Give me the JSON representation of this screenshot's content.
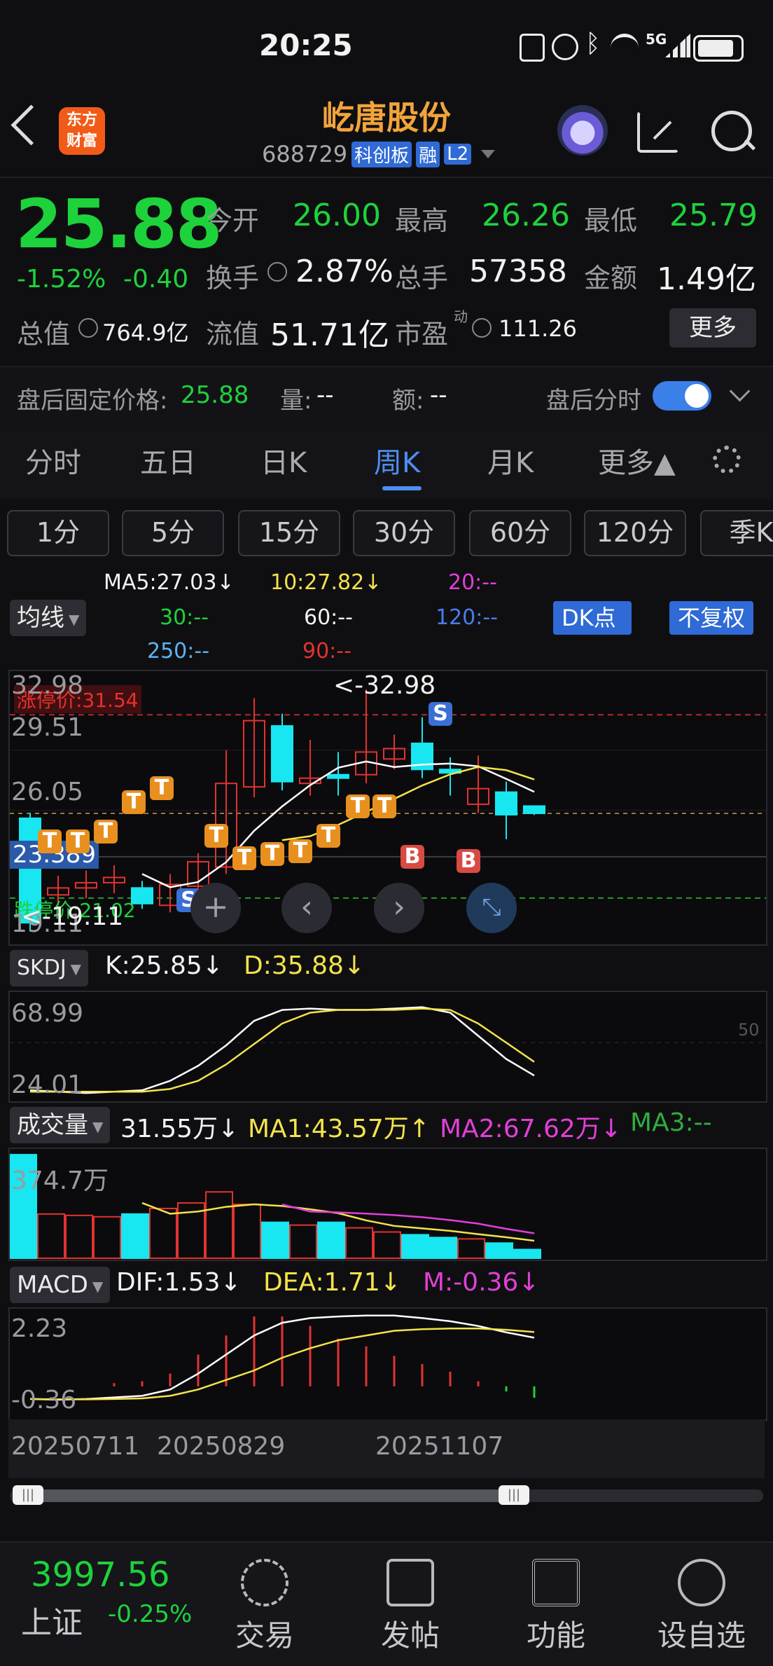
{
  "status_bar": {
    "time": "20:25",
    "network": "5G"
  },
  "header": {
    "logo_line1": "东方",
    "logo_line2": "财富",
    "title": "屹唐股份",
    "code": "688729",
    "badge_board": "科创板",
    "badge_margin": "融",
    "badge_level": "L2"
  },
  "quote": {
    "price": "25.88",
    "change_pct": "-1.52%",
    "change_abs": "-0.40",
    "open_label": "今开",
    "open": "26.00",
    "high_label": "最高",
    "high": "26.26",
    "low_label": "最低",
    "low": "25.79",
    "turnover_label": "换手",
    "turnover": "2.87%",
    "volume_label": "总手",
    "volume": "57358",
    "amount_label": "金额",
    "amount": "1.49亿",
    "mktcap_label": "总值",
    "mktcap": "764.9亿",
    "float_label": "流值",
    "float": "51.71亿",
    "pe_label": "市盈",
    "pe_sup": "动",
    "pe": "111.26",
    "more_label": "更多"
  },
  "after_hours": {
    "fixed_label": "盘后固定价格:",
    "fixed_price": "25.88",
    "vol_label": "量:",
    "vol": "--",
    "amt_label": "额:",
    "amt": "--",
    "toggle_label": "盘后分时"
  },
  "tabs": [
    "分时",
    "五日",
    "日K",
    "周K",
    "月K",
    "更多▲"
  ],
  "periods": [
    "1分",
    "5分",
    "15分",
    "30分",
    "60分",
    "120分",
    "季K"
  ],
  "ma_legend": {
    "chip": "均线",
    "ma5": "MA5:27.03↓",
    "ma10": "10:27.82↓",
    "ma20": "20:--",
    "ma30": "30:--",
    "ma60": "60:--",
    "ma120": "120:--",
    "ma250": "250:--",
    "ma90": "90:--",
    "dk_label": "DK点",
    "adjust_label": "不复权"
  },
  "kline": {
    "limit_up": "涨停价:31.54",
    "limit_down": "跌停价:21.02",
    "axis_top": "32.98",
    "axis_2": "29.51",
    "axis_3": "26.05",
    "axis_cur": "23.389",
    "axis_bottom": "19.11",
    "max_note": "<-32.98",
    "min_note": "<-19.11",
    "candles": [
      {
        "o": 19.6,
        "c": 25.6,
        "h": 25.9,
        "l": 19.1,
        "up": false
      },
      {
        "o": 21.2,
        "c": 21.6,
        "h": 22.3,
        "l": 20.6,
        "up": true
      },
      {
        "o": 21.6,
        "c": 21.9,
        "h": 22.6,
        "l": 21.0,
        "up": true
      },
      {
        "o": 21.9,
        "c": 22.2,
        "h": 22.9,
        "l": 21.3,
        "up": true
      },
      {
        "o": 21.6,
        "c": 20.7,
        "h": 22.0,
        "l": 20.4,
        "up": false
      },
      {
        "o": 20.6,
        "c": 21.8,
        "h": 22.4,
        "l": 20.2,
        "up": true
      },
      {
        "o": 21.7,
        "c": 23.1,
        "h": 23.6,
        "l": 21.3,
        "up": true
      },
      {
        "o": 22.8,
        "c": 27.6,
        "h": 29.5,
        "l": 22.4,
        "up": true
      },
      {
        "o": 27.4,
        "c": 31.2,
        "h": 32.5,
        "l": 26.8,
        "up": true
      },
      {
        "o": 30.9,
        "c": 27.7,
        "h": 31.6,
        "l": 27.2,
        "up": false
      },
      {
        "o": 27.6,
        "c": 27.9,
        "h": 30.1,
        "l": 26.9,
        "up": true
      },
      {
        "o": 27.9,
        "c": 28.1,
        "h": 29.4,
        "l": 26.9,
        "up": false
      },
      {
        "o": 28.1,
        "c": 29.4,
        "h": 33.0,
        "l": 27.6,
        "up": true
      },
      {
        "o": 29.0,
        "c": 29.6,
        "h": 30.4,
        "l": 28.4,
        "up": true
      },
      {
        "o": 29.9,
        "c": 28.4,
        "h": 31.4,
        "l": 27.9,
        "up": false
      },
      {
        "o": 28.4,
        "c": 28.2,
        "h": 29.1,
        "l": 26.9,
        "up": false
      },
      {
        "o": 26.4,
        "c": 27.3,
        "h": 29.2,
        "l": 25.9,
        "up": true
      },
      {
        "o": 27.1,
        "c": 25.8,
        "h": 27.7,
        "l": 24.4,
        "up": false
      },
      {
        "o": 26.3,
        "c": 25.88,
        "h": 26.26,
        "l": 25.79,
        "up": false
      }
    ]
  },
  "skdj": {
    "chip": "SKDJ",
    "k": "K:25.85↓",
    "d": "D:35.88↓",
    "axis_top": "68.99",
    "axis_bottom": "24.01",
    "mid": "50"
  },
  "volume": {
    "chip": "成交量",
    "cur": "31.55万↓",
    "ma1": "MA1:43.57万↑",
    "ma2": "MA2:67.62万↓",
    "ma3": "MA3:--",
    "axis_top": "374.7万"
  },
  "macd": {
    "chip": "MACD",
    "dif": "DIF:1.53↓",
    "dea": "DEA:1.71↓",
    "m": "M:-0.36↓",
    "axis_top": "2.23",
    "axis_bottom": "-0.36"
  },
  "dates": [
    "20250711",
    "20250829",
    "20251107"
  ],
  "bottom_bar": {
    "index_value": "3997.56",
    "index_name": "上证",
    "index_change": "-0.25%",
    "nav": [
      "交易",
      "发帖",
      "功能",
      "设自选"
    ]
  }
}
